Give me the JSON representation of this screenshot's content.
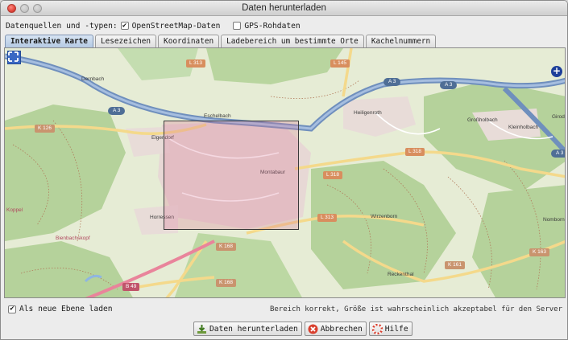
{
  "window": {
    "title": "Daten herunterladen"
  },
  "sources": {
    "label": "Datenquellen und -typen:",
    "osm": {
      "label": "OpenStreetMap-Daten",
      "checked": true
    },
    "gps": {
      "label": "GPS-Rohdaten",
      "checked": false
    }
  },
  "tabs": [
    {
      "label": "Interaktive Karte",
      "active": true
    },
    {
      "label": "Lesezeichen",
      "active": false
    },
    {
      "label": "Koordinaten",
      "active": false
    },
    {
      "label": "Ladebereich um bestimmte Orte",
      "active": false
    },
    {
      "label": "Kachelnummern",
      "active": false
    }
  ],
  "map": {
    "places": [
      "Dernbach",
      "Eschelbach",
      "Heiligenroth",
      "Großholbach",
      "Kleinholbach",
      "Girod",
      "Elgendorf",
      "Montabaur",
      "Wirzenborn",
      "Koppel",
      "Horressen",
      "Bienbachskopf",
      "Nomborn",
      "Reckenthal",
      "Montabaur",
      "Heiligenroth",
      "Eschelbach"
    ],
    "roads": {
      "l313a": "L 313",
      "a3a": "A 3",
      "a3b": "A 3",
      "a3c": "A 3",
      "a3d": "A 3",
      "a3e": "A 3",
      "l145": "L 145",
      "k126": "K 126",
      "l318a": "L 318",
      "l318b": "L 318",
      "l313b": "L 313",
      "k168a": "K 168",
      "k168b": "K 168",
      "k161": "K 161",
      "k163": "K 163",
      "b49": "B 49"
    },
    "accent": "#3a68c4",
    "selection_color": "#dc7896"
  },
  "options": {
    "new_layer": {
      "label": "Als neue Ebene laden",
      "checked": true
    }
  },
  "status": "Bereich korrekt, Größe ist wahrscheinlich akzeptabel für den Server",
  "buttons": {
    "download": "Daten herunterladen",
    "cancel": "Abbrechen",
    "help": "Hilfe"
  },
  "icons": {
    "download": "download-icon",
    "cancel": "cancel-icon",
    "help": "help-icon",
    "fullscreen": "fullscreen-icon",
    "zoom": "zoom-in-icon"
  }
}
